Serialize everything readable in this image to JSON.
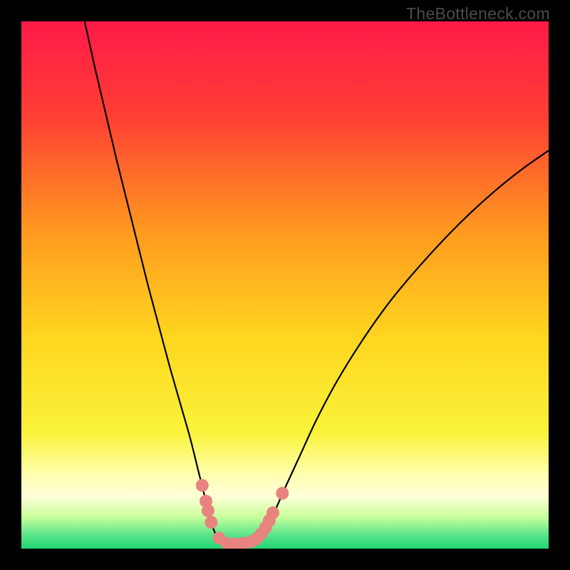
{
  "watermark": "TheBottleneck.com",
  "chart_data": {
    "type": "line",
    "title": "",
    "xlabel": "",
    "ylabel": "",
    "xlim": [
      0,
      100
    ],
    "ylim": [
      0,
      100
    ],
    "background_gradient": {
      "stops": [
        {
          "offset": 0.0,
          "color": "#ff1a48"
        },
        {
          "offset": 0.18,
          "color": "#ff3f34"
        },
        {
          "offset": 0.4,
          "color": "#ff9a1f"
        },
        {
          "offset": 0.6,
          "color": "#ffd61f"
        },
        {
          "offset": 0.78,
          "color": "#f9f33a"
        },
        {
          "offset": 0.86,
          "color": "#ffffb0"
        },
        {
          "offset": 0.9,
          "color": "#ffffd8"
        },
        {
          "offset": 0.94,
          "color": "#c8ff9a"
        },
        {
          "offset": 0.975,
          "color": "#57e48c"
        },
        {
          "offset": 1.0,
          "color": "#21d672"
        }
      ]
    },
    "series": [
      {
        "name": "left-branch",
        "color": "#000000",
        "points": [
          {
            "x": 12.0,
            "y": 100.0
          },
          {
            "x": 14.0,
            "y": 91.0
          },
          {
            "x": 16.0,
            "y": 82.5
          },
          {
            "x": 18.0,
            "y": 74.0
          },
          {
            "x": 20.0,
            "y": 66.0
          },
          {
            "x": 22.0,
            "y": 58.0
          },
          {
            "x": 24.0,
            "y": 50.0
          },
          {
            "x": 26.0,
            "y": 42.5
          },
          {
            "x": 28.0,
            "y": 35.0
          },
          {
            "x": 30.0,
            "y": 28.0
          },
          {
            "x": 32.0,
            "y": 21.0
          },
          {
            "x": 33.5,
            "y": 15.0
          },
          {
            "x": 35.0,
            "y": 9.0
          },
          {
            "x": 36.0,
            "y": 5.0
          },
          {
            "x": 37.0,
            "y": 2.5
          },
          {
            "x": 38.5,
            "y": 1.2
          },
          {
            "x": 40.0,
            "y": 0.8
          }
        ]
      },
      {
        "name": "right-branch",
        "color": "#000000",
        "points": [
          {
            "x": 40.0,
            "y": 0.8
          },
          {
            "x": 42.0,
            "y": 1.0
          },
          {
            "x": 44.0,
            "y": 1.5
          },
          {
            "x": 46.0,
            "y": 3.5
          },
          {
            "x": 48.0,
            "y": 7.0
          },
          {
            "x": 50.0,
            "y": 11.5
          },
          {
            "x": 53.0,
            "y": 18.0
          },
          {
            "x": 56.0,
            "y": 24.5
          },
          {
            "x": 60.0,
            "y": 32.0
          },
          {
            "x": 65.0,
            "y": 40.0
          },
          {
            "x": 70.0,
            "y": 47.0
          },
          {
            "x": 75.0,
            "y": 53.0
          },
          {
            "x": 80.0,
            "y": 58.5
          },
          {
            "x": 85.0,
            "y": 63.5
          },
          {
            "x": 90.0,
            "y": 68.0
          },
          {
            "x": 95.0,
            "y": 72.0
          },
          {
            "x": 100.0,
            "y": 75.5
          }
        ]
      }
    ],
    "markers": {
      "name": "highlight-dots",
      "color": "#e8837f",
      "radius_px": 9,
      "points": [
        {
          "x": 34.3,
          "y": 12.0
        },
        {
          "x": 35.0,
          "y": 9.0
        },
        {
          "x": 35.4,
          "y": 7.2
        },
        {
          "x": 36.0,
          "y": 5.0
        },
        {
          "x": 37.5,
          "y": 2.0
        },
        {
          "x": 39.0,
          "y": 1.0
        },
        {
          "x": 40.5,
          "y": 0.9
        },
        {
          "x": 42.0,
          "y": 1.0
        },
        {
          "x": 43.5,
          "y": 1.3
        },
        {
          "x": 44.5,
          "y": 1.8
        },
        {
          "x": 45.5,
          "y": 2.8
        },
        {
          "x": 46.3,
          "y": 4.0
        },
        {
          "x": 47.0,
          "y": 5.3
        },
        {
          "x": 47.7,
          "y": 6.8
        },
        {
          "x": 49.5,
          "y": 10.5
        }
      ]
    }
  }
}
